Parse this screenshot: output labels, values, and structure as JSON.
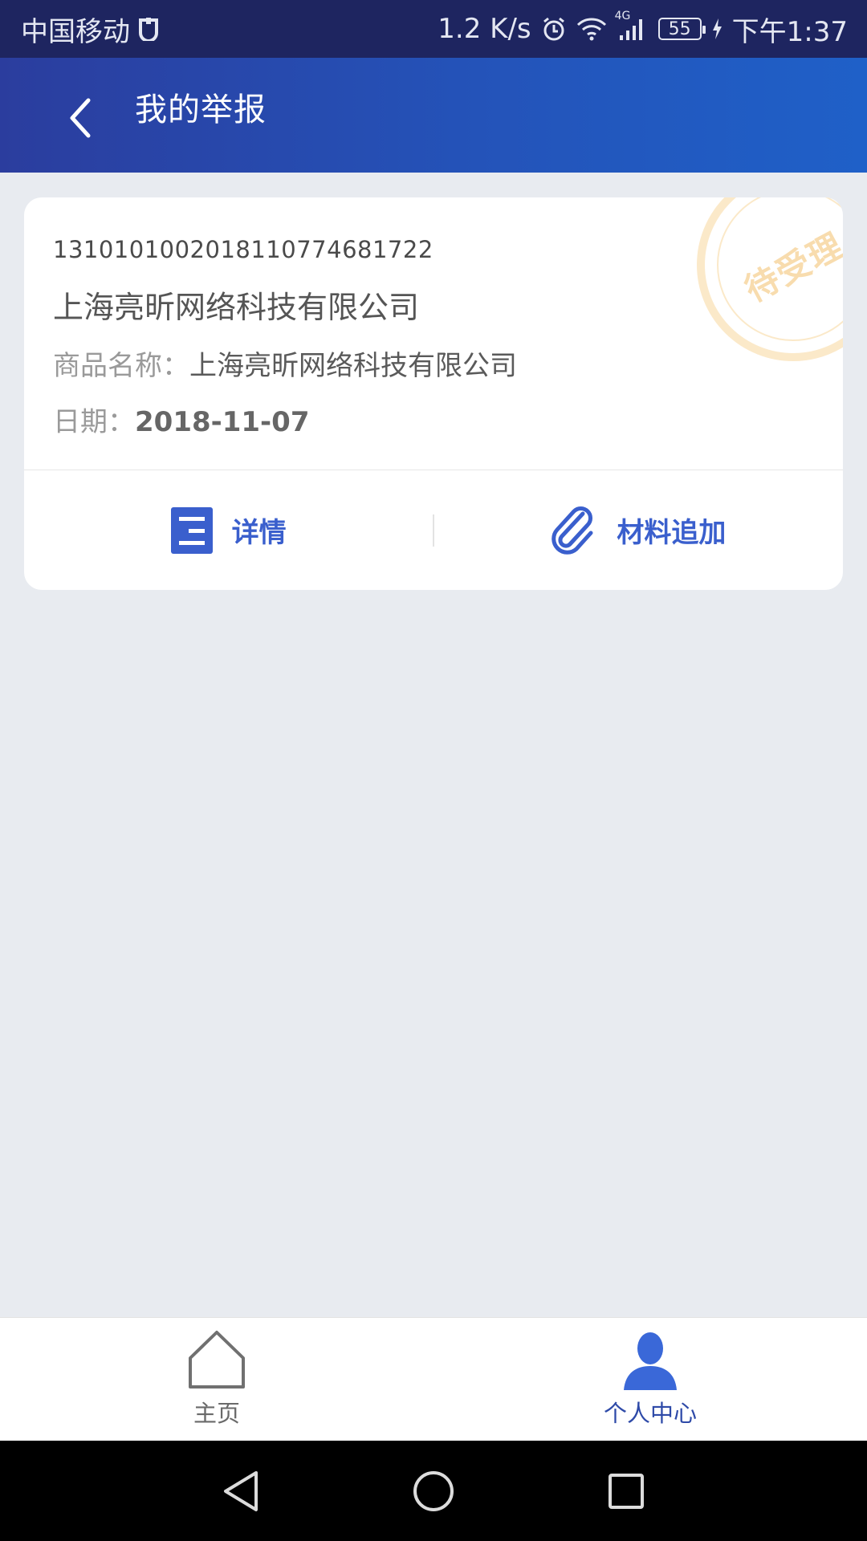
{
  "status_bar": {
    "carrier": "中国移动",
    "speed": "1.2 K/s",
    "network": "4G",
    "battery": "55",
    "time": "下午1:37"
  },
  "header": {
    "title": "我的举报"
  },
  "report": {
    "id": "1310101002018110774681722",
    "company": "上海亮昕网络科技有限公司",
    "product_label": "商品名称：",
    "product_value": "上海亮昕网络科技有限公司",
    "date_label": "日期：",
    "date_value": "2018-11-07",
    "status_stamp": "待受理",
    "actions": {
      "detail": "详情",
      "add_material": "材料追加"
    }
  },
  "bottom_nav": {
    "home": "主页",
    "profile": "个人中心"
  },
  "colors": {
    "accent": "#3a5fcd",
    "header_start": "#2b3d9e",
    "header_end": "#1f60c8",
    "stamp": "#f8dcae"
  }
}
